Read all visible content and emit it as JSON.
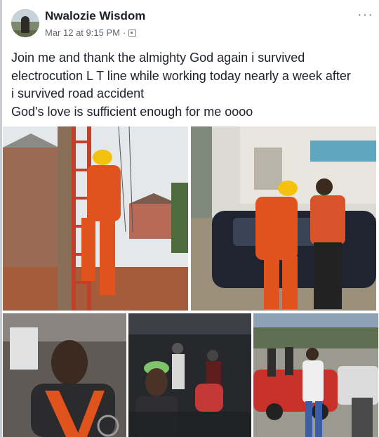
{
  "post": {
    "author": "Nwalozie Wisdom",
    "timestamp": "Mar 12 at 9:15 PM",
    "separator": "·",
    "more_label": "···",
    "audience_icon": "audience-icon",
    "text_lines": [
      "Join me and thank the almighty God again i survived",
      "electrocution L T line while working today nearly a week after",
      "i survived road accident",
      "God's love is sufficient enough for me oooo"
    ]
  },
  "colors": {
    "name": "#1d2129",
    "meta": "#616770",
    "overall_orange": "#e0531c",
    "helmet_yellow": "#f4c20d"
  }
}
